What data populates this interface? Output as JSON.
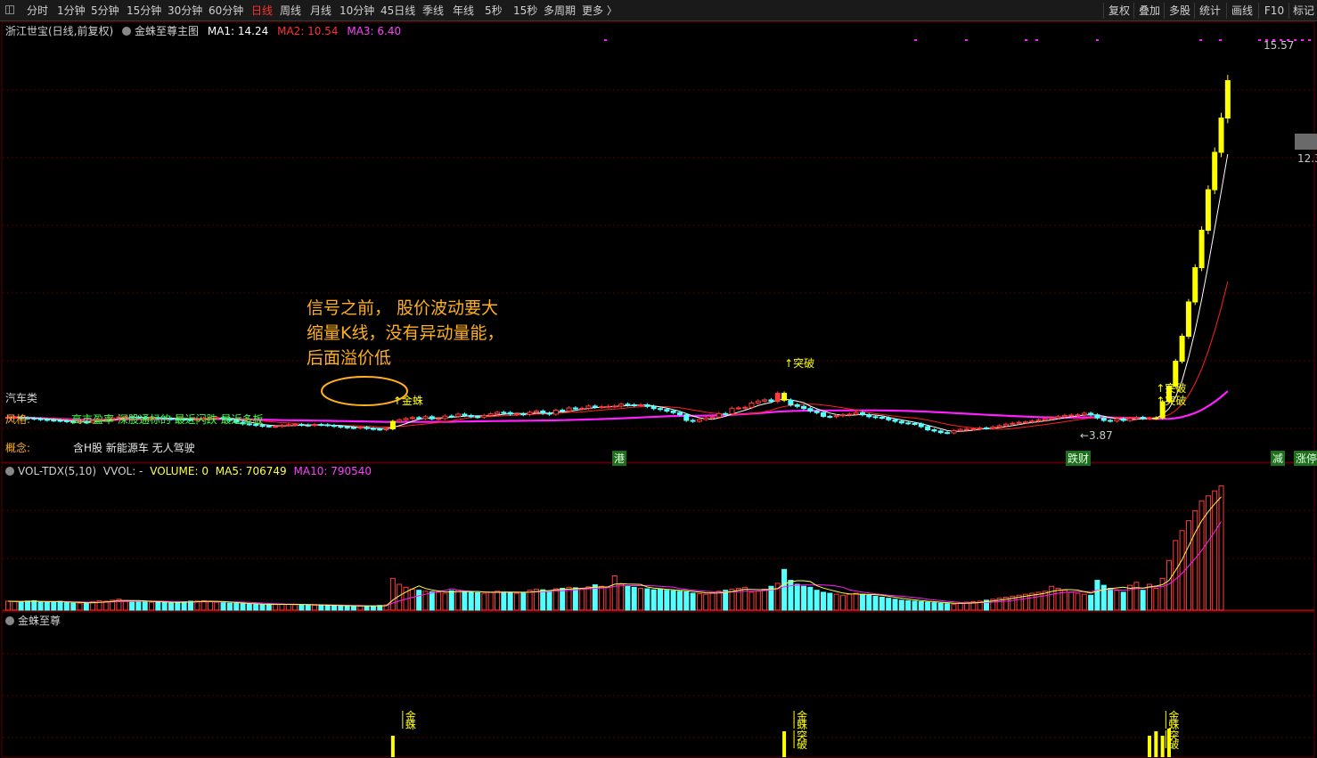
{
  "toolbar": {
    "periods": [
      "分时",
      "1分钟",
      "5分钟",
      "15分钟",
      "30分钟",
      "60分钟",
      "日线",
      "周线",
      "月线",
      "10分钟",
      "45日线",
      "季线",
      "年线",
      "5秒",
      "15秒",
      "多周期",
      "更多 〉"
    ],
    "active_period": "日线",
    "right_buttons": [
      "复权",
      "叠加",
      "多股",
      "统计",
      "画线",
      "F10",
      "标记"
    ]
  },
  "main_header": {
    "stock": "浙江世宝(日线,前复权)",
    "indicator": "金蛛至尊主图",
    "ma1": "MA1: 14.24",
    "ma2": "MA2: 10.54",
    "ma3": "MA3: 6.40"
  },
  "info": {
    "industry": "汽车类",
    "style_label": "风格:",
    "style_tags": "高市盈率  深股通标的  最近闪跌  最近多板",
    "concept_label": "概念:",
    "concept_tags": "含H股  新能源车  无人驾驶"
  },
  "annotation": {
    "line1": "信号之前，  股价波动要大",
    "line2": "缩量K线，没有异动量能，",
    "line3": "后面溢价低"
  },
  "event_tags": [
    "港",
    "跌财",
    "减",
    "涨停"
  ],
  "vol_header": {
    "name": "VOL-TDX(5,10)",
    "vvol": "VVOL: -",
    "volume": "VOLUME: 0",
    "ma5": "MA5: 706749",
    "ma10": "MA10: 790540"
  },
  "sub_header": {
    "name": "金蛛至尊"
  },
  "colors": {
    "up": "#ff3b3b",
    "down": "#54ffff",
    "signal": "#ffff00",
    "ma1": "#ffffff",
    "ma2": "#ff2020",
    "ma3": "#ff20ff",
    "annot": "#ffb020",
    "grid": "#5a0000"
  },
  "chart_data": [
    {
      "type": "candlestick",
      "title": "浙江世宝(日线,前复权)",
      "price_labels": {
        "high": "15.57",
        "low": "3.87",
        "right_axis_label": "12.3"
      },
      "ylim": [
        3.5,
        16.5
      ],
      "signals": [
        {
          "index": 59,
          "label": "金蛛"
        },
        {
          "index": 119,
          "label": "突破"
        },
        {
          "index": 176,
          "label": "突破"
        },
        {
          "index": 176,
          "label": "突破"
        }
      ],
      "closes": [
        4.4,
        4.4,
        4.38,
        4.37,
        4.35,
        4.33,
        4.31,
        4.3,
        4.29,
        4.26,
        4.25,
        4.25,
        4.24,
        4.29,
        4.32,
        4.34,
        4.38,
        4.41,
        4.42,
        4.41,
        4.39,
        4.38,
        4.39,
        4.38,
        4.36,
        4.35,
        4.34,
        4.33,
        4.32,
        4.33,
        4.37,
        4.38,
        4.39,
        4.36,
        4.3,
        4.24,
        4.19,
        4.17,
        4.14,
        4.12,
        4.11,
        4.11,
        4.14,
        4.16,
        4.17,
        4.15,
        4.14,
        4.17,
        4.16,
        4.14,
        4.11,
        4.09,
        4.07,
        4.06,
        4.08,
        4.04,
        4.02,
        4.01,
        4.03,
        4.27,
        4.32,
        4.36,
        4.39,
        4.36,
        4.42,
        4.35,
        4.36,
        4.44,
        4.43,
        4.5,
        4.46,
        4.42,
        4.41,
        4.46,
        4.51,
        4.56,
        4.55,
        4.5,
        4.51,
        4.49,
        4.56,
        4.6,
        4.53,
        4.5,
        4.63,
        4.6,
        4.7,
        4.67,
        4.69,
        4.76,
        4.73,
        4.74,
        4.75,
        4.76,
        4.82,
        4.8,
        4.78,
        4.8,
        4.75,
        4.68,
        4.65,
        4.6,
        4.55,
        4.48,
        4.3,
        4.27,
        4.33,
        4.38,
        4.41,
        4.52,
        4.51,
        4.69,
        4.7,
        4.72,
        4.86,
        4.92,
        4.96,
        4.91,
        5.17,
        4.95,
        4.8,
        4.75,
        4.68,
        4.6,
        4.55,
        4.43,
        4.42,
        4.45,
        4.48,
        4.5,
        4.55,
        4.48,
        4.42,
        4.4,
        4.38,
        4.32,
        4.27,
        4.22,
        4.2,
        4.19,
        4.1,
        4.0,
        3.96,
        3.91,
        3.9,
        3.97,
        4.01,
        4.02,
        4.03,
        4.06,
        4.05,
        4.09,
        4.13,
        4.18,
        4.21,
        4.24,
        4.25,
        4.28,
        4.31,
        4.35,
        4.38,
        4.42,
        4.46,
        4.47,
        4.48,
        4.53,
        4.48,
        4.38,
        4.3,
        4.28,
        4.35,
        4.3,
        4.36,
        4.4,
        4.36,
        4.37,
        4.38,
        4.9,
        5.4,
        6.2,
        7.0,
        8.1,
        9.2,
        10.4,
        11.7,
        12.9,
        14.0,
        15.2
      ],
      "volumes": [
        90,
        88,
        85,
        92,
        95,
        80,
        78,
        85,
        90,
        75,
        70,
        72,
        68,
        85,
        95,
        90,
        100,
        110,
        95,
        90,
        88,
        85,
        80,
        82,
        78,
        75,
        80,
        85,
        90,
        92,
        95,
        88,
        80,
        75,
        70,
        68,
        65,
        60,
        58,
        55,
        56,
        60,
        62,
        58,
        55,
        54,
        52,
        50,
        48,
        46,
        45,
        44,
        42,
        41,
        40,
        42,
        44,
        48,
        52,
        320,
        260,
        230,
        210,
        200,
        190,
        185,
        180,
        170,
        195,
        200,
        190,
        180,
        175,
        170,
        180,
        190,
        185,
        175,
        170,
        180,
        200,
        210,
        205,
        190,
        215,
        220,
        230,
        225,
        210,
        235,
        255,
        240,
        230,
        345,
        260,
        240,
        230,
        220,
        215,
        205,
        210,
        200,
        195,
        190,
        185,
        170,
        165,
        160,
        175,
        190,
        200,
        210,
        220,
        230,
        180,
        190,
        210,
        240,
        270,
        410,
        300,
        260,
        240,
        230,
        200,
        180,
        170,
        160,
        150,
        160,
        170,
        160,
        150,
        140,
        130,
        120,
        110,
        100,
        95,
        90,
        85,
        80,
        75,
        70,
        65,
        60,
        70,
        80,
        85,
        90,
        100,
        110,
        120,
        130,
        140,
        150,
        160,
        170,
        180,
        190,
        240,
        220,
        200,
        180,
        170,
        160,
        150,
        300,
        250,
        220,
        200,
        180,
        250,
        280,
        200,
        260,
        220,
        320,
        500,
        700,
        800,
        900,
        1000,
        1100,
        1150,
        1200,
        1250
      ]
    }
  ]
}
